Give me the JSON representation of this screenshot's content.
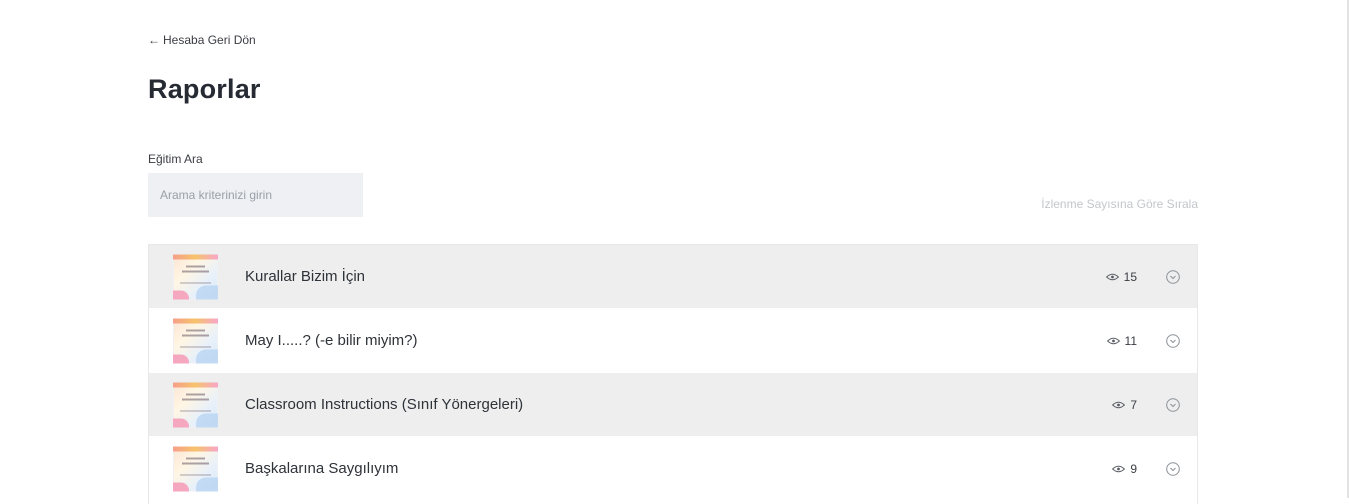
{
  "nav": {
    "back_label": "Hesaba Geri Dön",
    "back_arrow": "←"
  },
  "page": {
    "title": "Raporlar"
  },
  "search": {
    "label": "Eğitim Ara",
    "placeholder": "Arama kriterinizi girin",
    "value": ""
  },
  "sort": {
    "label": "İzlenme Sayısına Göre Sırala"
  },
  "reports": [
    {
      "title": "Kurallar Bizim İçin",
      "views": "15",
      "thumbnail": "course-cover-thumbnail"
    },
    {
      "title": "May I.....? (-e bilir miyim?)",
      "views": "11",
      "thumbnail": "course-cover-thumbnail"
    },
    {
      "title": "Classroom Instructions (Sınıf Yönergeleri)",
      "views": "7",
      "thumbnail": "course-cover-thumbnail"
    },
    {
      "title": "Başkalarına Saygılıyım",
      "views": "9",
      "thumbnail": "course-cover-thumbnail"
    }
  ],
  "icons": {
    "views": "eye-icon",
    "expand": "chevron-down-circle-icon"
  },
  "colors": {
    "row_shade": "#eeeeee",
    "input_bg": "#eef0f3",
    "title": "#252a33",
    "muted": "#c3c6cb"
  }
}
